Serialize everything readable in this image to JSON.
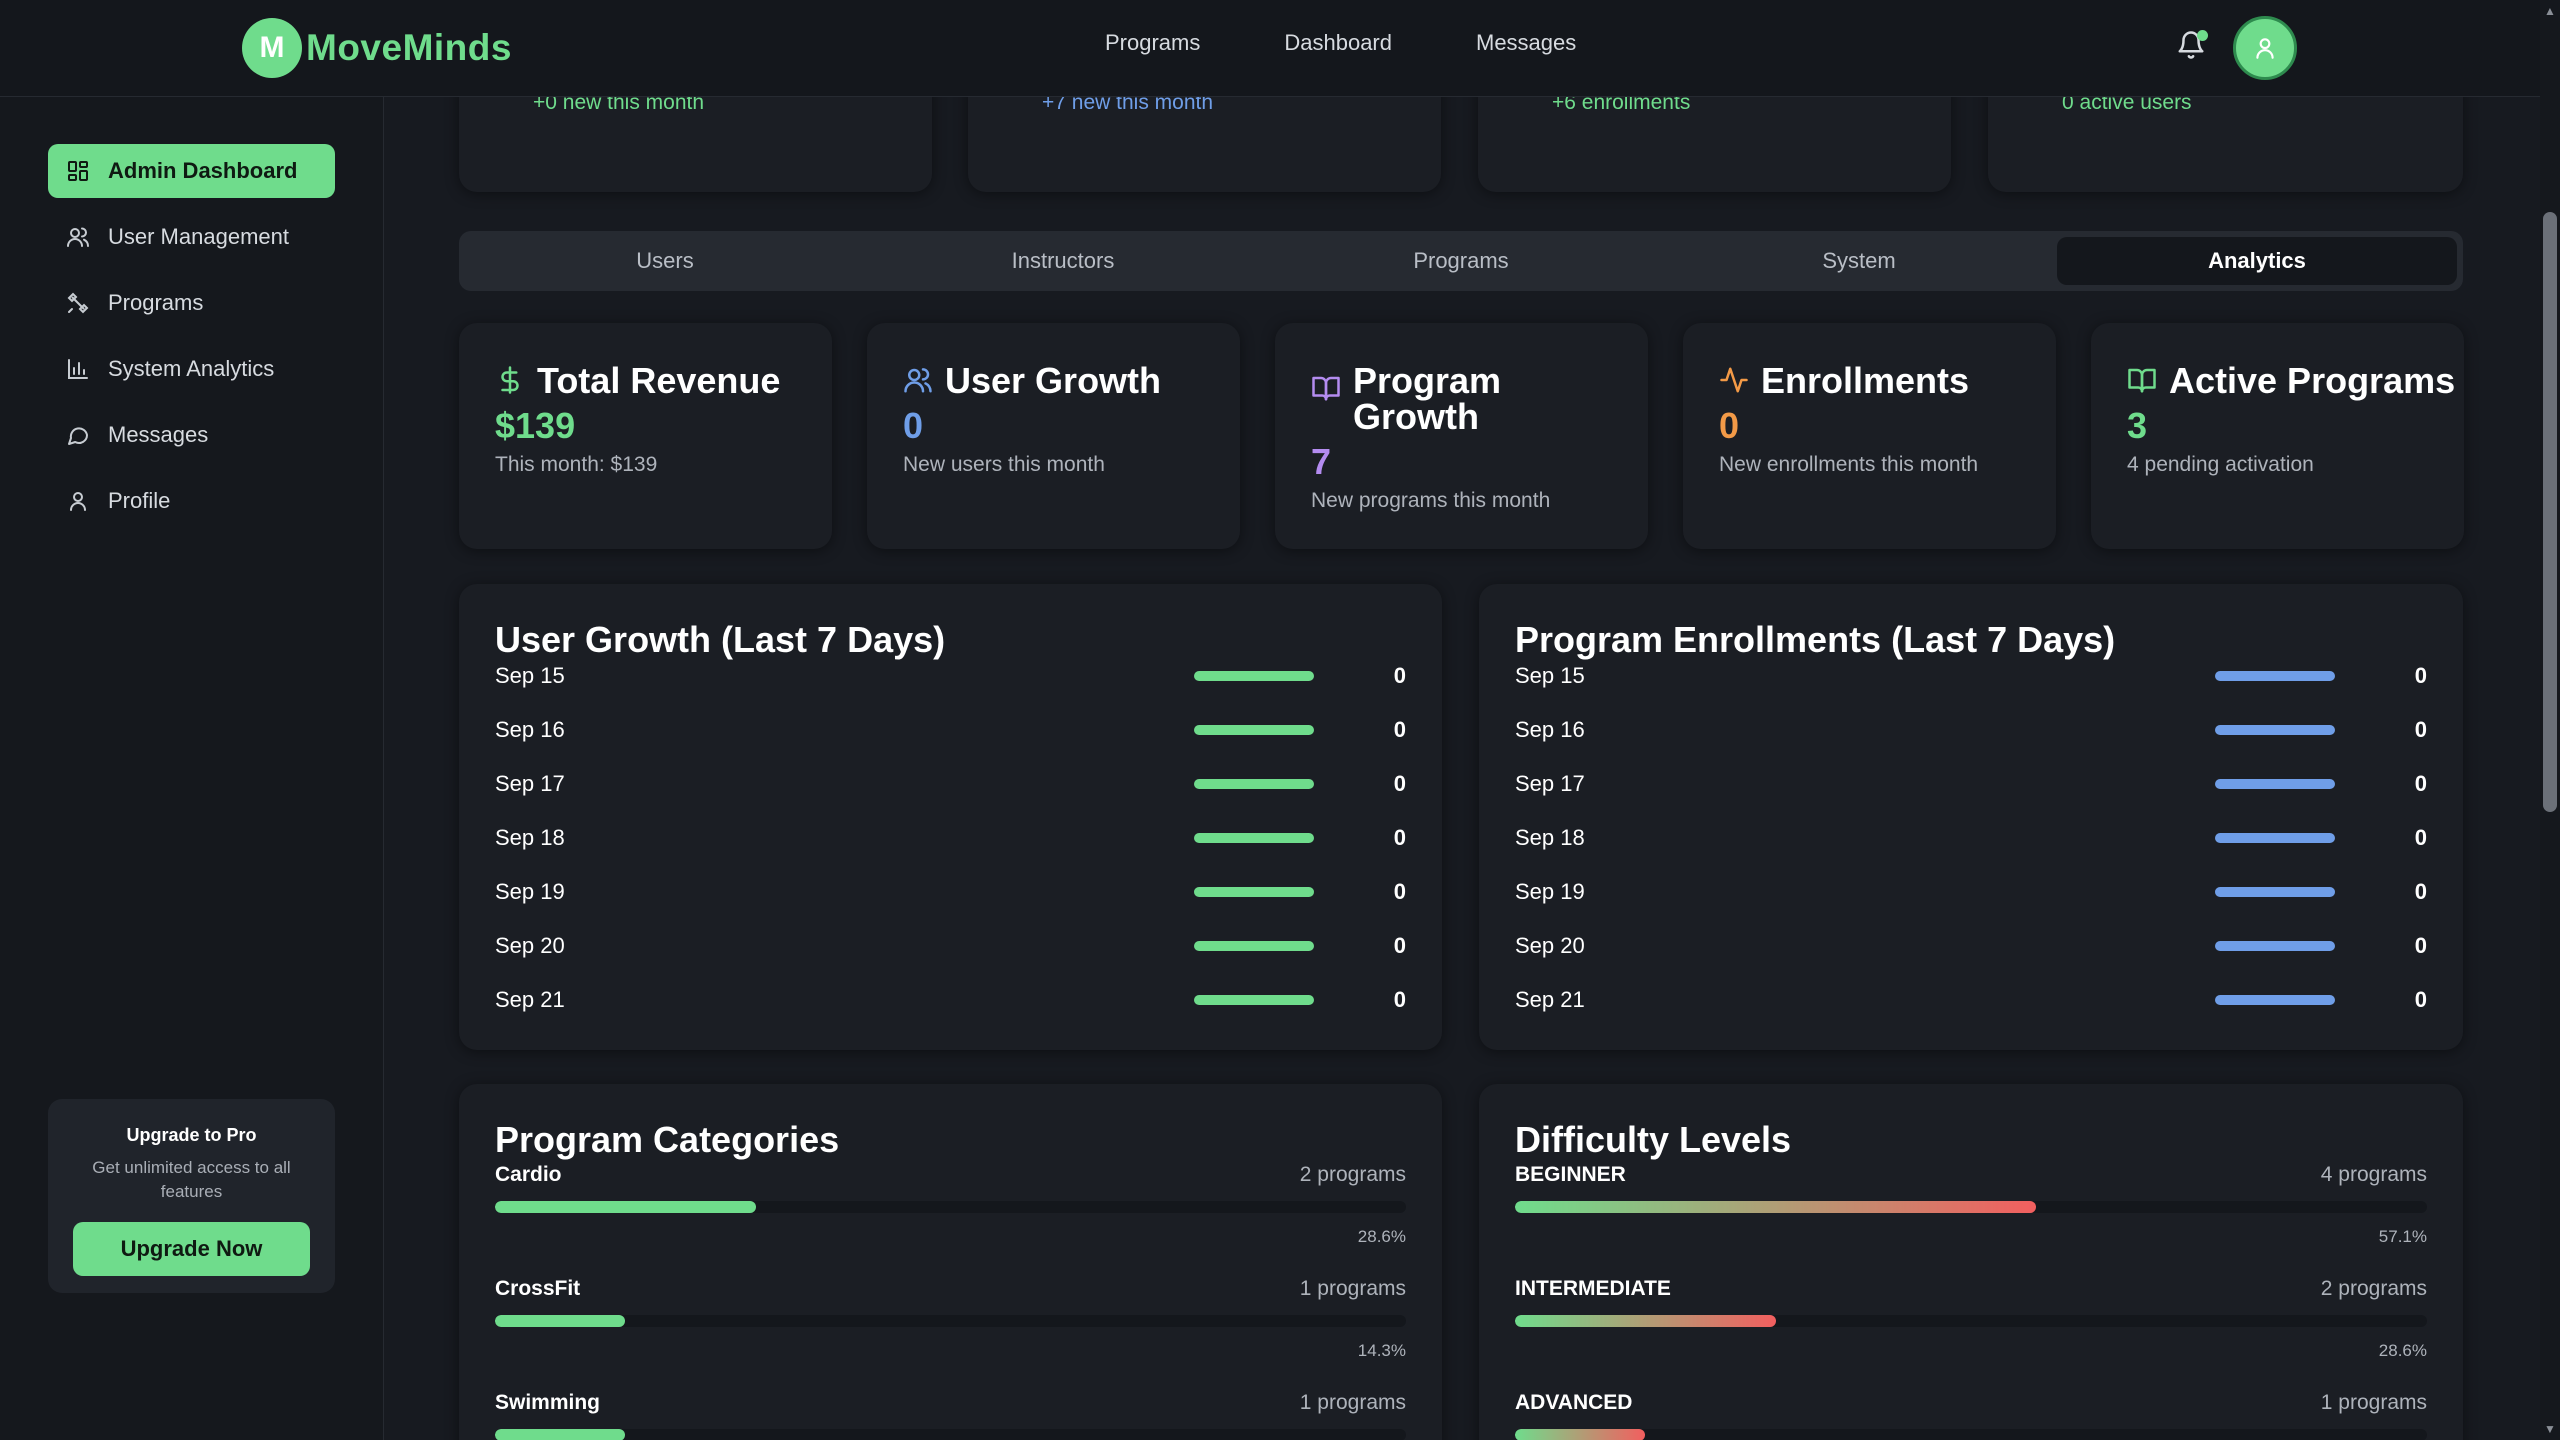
{
  "header": {
    "logo_letter": "M",
    "logo_text": "MoveMinds",
    "nav": [
      "Programs",
      "Dashboard",
      "Messages"
    ]
  },
  "sidebar": {
    "items": [
      {
        "label": "Admin Dashboard",
        "icon": "dashboard-grid-icon",
        "active": true
      },
      {
        "label": "User Management",
        "icon": "users-icon",
        "active": false
      },
      {
        "label": "Programs",
        "icon": "programs-icon",
        "active": false
      },
      {
        "label": "System Analytics",
        "icon": "bar-chart-icon",
        "active": false
      },
      {
        "label": "Messages",
        "icon": "message-icon",
        "active": false
      },
      {
        "label": "Profile",
        "icon": "user-icon",
        "active": false
      }
    ],
    "promo": {
      "title": "Upgrade to Pro",
      "subtitle": "Get unlimited access to all features",
      "button": "Upgrade Now"
    }
  },
  "top_stats": [
    {
      "text": "+0 new this month",
      "color": "#6fdc8c"
    },
    {
      "text": "+7 new this month",
      "color": "#6f9ee8"
    },
    {
      "text": "+6 enrollments",
      "color": "#6fdc8c"
    },
    {
      "text": "0 active users",
      "color": "#6fdc8c"
    }
  ],
  "tabs": {
    "items": [
      "Users",
      "Instructors",
      "Programs",
      "System",
      "Analytics"
    ],
    "active": "Analytics"
  },
  "stat_cards": [
    {
      "title": "Total Revenue",
      "value": "$139",
      "sub": "This month: $139",
      "color": "#6fdc8c",
      "icon": "dollar-icon"
    },
    {
      "title": "User Growth",
      "value": "0",
      "sub": "New users this month",
      "color": "#6f9ee8",
      "icon": "users-icon"
    },
    {
      "title": "Program Growth",
      "value": "7",
      "sub": "New programs this month",
      "color": "#b48cf0",
      "icon": "book-icon"
    },
    {
      "title": "Enrollments",
      "value": "0",
      "sub": "New enrollments this month",
      "color": "#f39a47",
      "icon": "activity-icon"
    },
    {
      "title": "Active Programs",
      "value": "3",
      "sub": "4 pending activation",
      "color": "#6fdc8c",
      "icon": "book-open-icon"
    }
  ],
  "user_growth": {
    "title": "User Growth (Last 7 Days)",
    "bar_color": "#6fdc8c",
    "rows": [
      {
        "date": "Sep 15",
        "value": "0"
      },
      {
        "date": "Sep 16",
        "value": "0"
      },
      {
        "date": "Sep 17",
        "value": "0"
      },
      {
        "date": "Sep 18",
        "value": "0"
      },
      {
        "date": "Sep 19",
        "value": "0"
      },
      {
        "date": "Sep 20",
        "value": "0"
      },
      {
        "date": "Sep 21",
        "value": "0"
      }
    ]
  },
  "program_enrollments": {
    "title": "Program Enrollments (Last 7 Days)",
    "bar_color": "#6f9ee8",
    "rows": [
      {
        "date": "Sep 15",
        "value": "0"
      },
      {
        "date": "Sep 16",
        "value": "0"
      },
      {
        "date": "Sep 17",
        "value": "0"
      },
      {
        "date": "Sep 18",
        "value": "0"
      },
      {
        "date": "Sep 19",
        "value": "0"
      },
      {
        "date": "Sep 20",
        "value": "0"
      },
      {
        "date": "Sep 21",
        "value": "0"
      }
    ]
  },
  "program_categories": {
    "title": "Program Categories",
    "items": [
      {
        "name": "Cardio",
        "count": "2 programs",
        "pct": "28.6%",
        "fraction": 0.286
      },
      {
        "name": "CrossFit",
        "count": "1 programs",
        "pct": "14.3%",
        "fraction": 0.143
      },
      {
        "name": "Swimming",
        "count": "1 programs",
        "pct": "",
        "fraction": 0.143
      }
    ]
  },
  "difficulty_levels": {
    "title": "Difficulty Levels",
    "items": [
      {
        "name": "BEGINNER",
        "count": "4 programs",
        "pct": "57.1%",
        "fraction": 0.571
      },
      {
        "name": "INTERMEDIATE",
        "count": "2 programs",
        "pct": "28.6%",
        "fraction": 0.286
      },
      {
        "name": "ADVANCED",
        "count": "1 programs",
        "pct": "",
        "fraction": 0.143
      }
    ]
  }
}
